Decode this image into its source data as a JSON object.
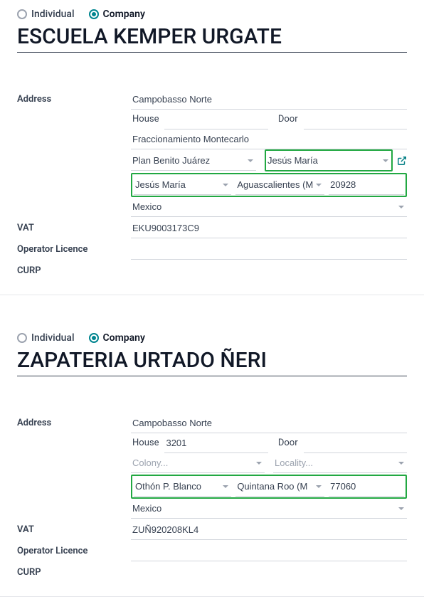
{
  "records": [
    {
      "radio": {
        "individual": "Individual",
        "company": "Company",
        "selected": "company"
      },
      "title": "ESCUELA KEMPER URGATE",
      "labels": {
        "address": "Address",
        "vat": "VAT",
        "operator": "Operator Licence",
        "curp": "CURP",
        "house": "House",
        "door": "Door"
      },
      "address": {
        "street": "Campobasso Norte",
        "house": "",
        "door": "",
        "street2": "Fraccionamiento Montecarlo",
        "locality_left": "Plan Benito Juárez",
        "locality_right": "Jesús María",
        "city": "Jesús María",
        "state": "Aguascalientes (M",
        "zip": "20928",
        "country": "Mexico"
      },
      "placeholders": {
        "colony": "",
        "locality": ""
      },
      "vat": "EKU9003173C9",
      "operator": "",
      "curp": ""
    },
    {
      "radio": {
        "individual": "Individual",
        "company": "Company",
        "selected": "company"
      },
      "title": "ZAPATERIA URTADO ÑERI",
      "labels": {
        "address": "Address",
        "vat": "VAT",
        "operator": "Operator Licence",
        "curp": "CURP",
        "house": "House",
        "door": "Door"
      },
      "address": {
        "street": "Campobasso Norte",
        "house": "3201",
        "door": "",
        "street2": "",
        "locality_left": "",
        "locality_right": "",
        "city": "Othón P. Blanco",
        "state": "Quintana Roo (M",
        "zip": "77060",
        "country": "Mexico"
      },
      "placeholders": {
        "colony": "Colony...",
        "locality": "Locality..."
      },
      "vat": "ZUÑ920208KL4",
      "operator": "",
      "curp": ""
    }
  ]
}
